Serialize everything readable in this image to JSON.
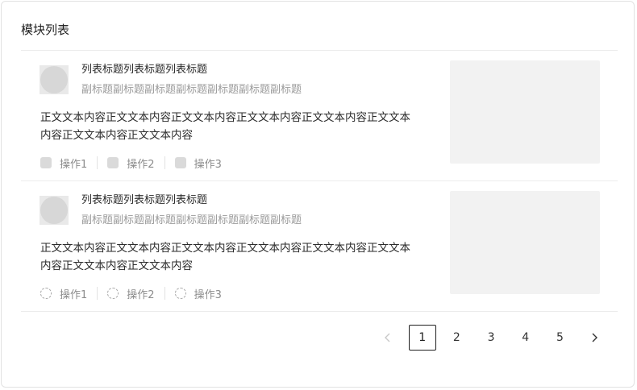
{
  "module": {
    "title": "模块列表"
  },
  "list": [
    {
      "title": "列表标题列表标题列表标题",
      "subtitle": "副标题副标题副标题副标题副标题副标题副标题",
      "body": "正文文本内容正文文本内容正文文本内容正文文本内容正文文本内容正文文本内容正文文本内容正文文本内容",
      "actions": [
        {
          "label": "操作1",
          "icon": "square-icon"
        },
        {
          "label": "操作2",
          "icon": "square-icon"
        },
        {
          "label": "操作3",
          "icon": "square-icon"
        }
      ]
    },
    {
      "title": "列表标题列表标题列表标题",
      "subtitle": "副标题副标题副标题副标题副标题副标题副标题",
      "body": "正文文本内容正文文本内容正文文本内容正文文本内容正文文本内容正文文本内容正文文本内容正文文本内容",
      "actions": [
        {
          "label": "操作1",
          "icon": "dashed-circle-icon"
        },
        {
          "label": "操作2",
          "icon": "dashed-circle-icon"
        },
        {
          "label": "操作3",
          "icon": "dashed-circle-icon"
        }
      ]
    }
  ],
  "pagination": {
    "pages": [
      "1",
      "2",
      "3",
      "4",
      "5"
    ],
    "current": "1",
    "prev_icon": "chevron-left-icon",
    "next_icon": "chevron-right-icon"
  },
  "colors": {
    "border": "#e2e2e2",
    "placeholder": "#f2f2f2",
    "avatar": "#d7d7d7",
    "active_page_border": "#1f1f1f"
  }
}
